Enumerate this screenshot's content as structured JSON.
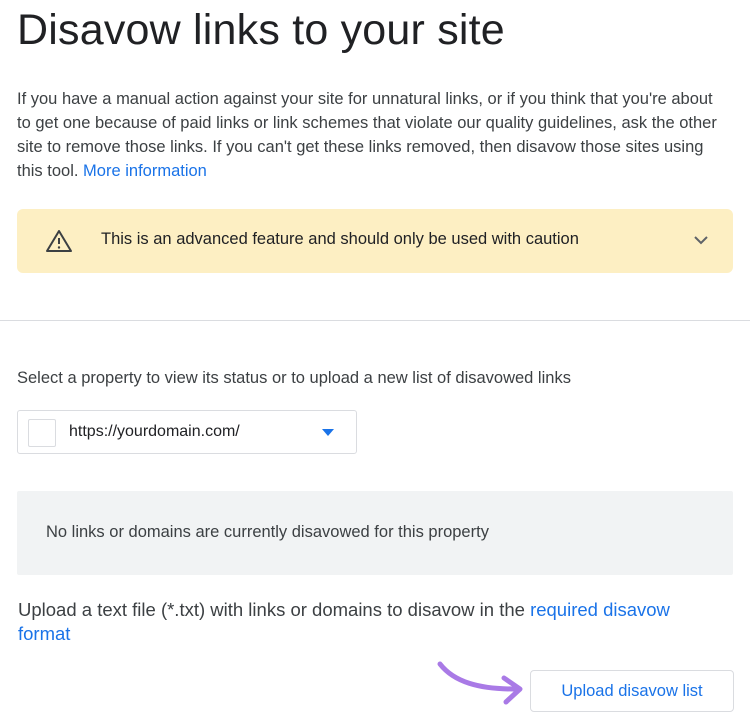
{
  "header": {
    "title": "Disavow links to your site"
  },
  "intro": {
    "text": "If you have a manual action against your site for unnatural links, or if you think that you're about to get one because of paid links or link schemes that violate our quality guidelines, ask the other site to remove those links. If you can't get these links removed, then disavow those sites using this tool.",
    "link_label": "More information"
  },
  "caution": {
    "icon": "warning-triangle-icon",
    "text": "This is an advanced feature and should only be used with caution",
    "expand_icon": "chevron-down-icon",
    "background": "#fdefc3"
  },
  "property": {
    "label": "Select a property to view its status or to upload a new list of disavowed links",
    "selected_value": "https://yourdomain.com/",
    "caret_icon": "dropdown-caret-icon"
  },
  "status": {
    "message": "No links or domains are currently disavowed for this property"
  },
  "upload": {
    "note_text": "Upload a text file (*.txt) with links or domains to disavow in the",
    "format_link_label": "required disavow format",
    "button_label": "Upload disavow list"
  },
  "colors": {
    "accent": "#1a73e8",
    "annotation_arrow": "#a97ae6"
  }
}
